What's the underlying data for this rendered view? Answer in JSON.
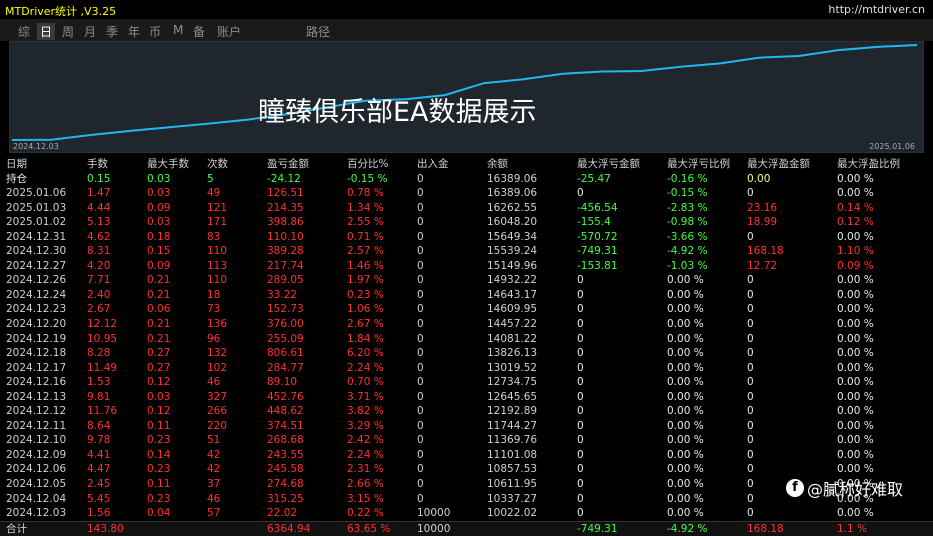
{
  "window": {
    "title": "MTDriver统计 ,V3.25",
    "url": "http://mtdriver.cn"
  },
  "tabs": [
    "综",
    "日",
    "周",
    "月",
    "季",
    "年",
    "币",
    "M",
    "备",
    "账户",
    "路径"
  ],
  "active_tab": "日",
  "chart": {
    "start_date": "2024.12.03",
    "end_date": "2025.01.06",
    "overlay": "瞳臻俱乐部EA数据展示",
    "line_color": "#1fb8f0"
  },
  "columns": [
    "日期",
    "手数",
    "最大手数",
    "次数",
    "盈亏金额",
    "百分比%",
    "出入金",
    "余额",
    "最大浮亏金额",
    "最大浮亏比例",
    "最大浮盈金额",
    "最大浮盈比例"
  ],
  "hold_row": [
    "持仓",
    "0.15",
    "0.03",
    "5",
    "-24.12",
    "-0.15 %",
    "0",
    "16389.06",
    "-25.47",
    "-0.16 %",
    "0.00",
    "0.00 %"
  ],
  "rows": [
    [
      "2025.01.06",
      "1.47",
      "0.03",
      "49",
      "126.51",
      "0.78 %",
      "0",
      "16389.06",
      "0",
      "-0.15 %",
      "0",
      "0.00 %"
    ],
    [
      "2025.01.03",
      "4.44",
      "0.09",
      "121",
      "214.35",
      "1.34 %",
      "0",
      "16262.55",
      "-456.54",
      "-2.83 %",
      "23.16",
      "0.14 %"
    ],
    [
      "2025.01.02",
      "5.13",
      "0.03",
      "171",
      "398.86",
      "2.55 %",
      "0",
      "16048.20",
      "-155.4",
      "-0.98 %",
      "18.99",
      "0.12 %"
    ],
    [
      "2024.12.31",
      "4.62",
      "0.18",
      "83",
      "110.10",
      "0.71 %",
      "0",
      "15649.34",
      "-570.72",
      "-3.66 %",
      "0",
      "0.00 %"
    ],
    [
      "2024.12.30",
      "8.31",
      "0.15",
      "110",
      "389.28",
      "2.57 %",
      "0",
      "15539.24",
      "-749.31",
      "-4.92 %",
      "168.18",
      "1.10 %"
    ],
    [
      "2024.12.27",
      "4.20",
      "0.09",
      "113",
      "217.74",
      "1.46 %",
      "0",
      "15149.96",
      "-153.81",
      "-1.03 %",
      "12.72",
      "0.09 %"
    ],
    [
      "2024.12.26",
      "7.71",
      "0.21",
      "110",
      "289.05",
      "1.97 %",
      "0",
      "14932.22",
      "0",
      "0.00 %",
      "0",
      "0.00 %"
    ],
    [
      "2024.12.24",
      "2.40",
      "0.21",
      "18",
      "33.22",
      "0.23 %",
      "0",
      "14643.17",
      "0",
      "0.00 %",
      "0",
      "0.00 %"
    ],
    [
      "2024.12.23",
      "2.67",
      "0.06",
      "73",
      "152.73",
      "1.06 %",
      "0",
      "14609.95",
      "0",
      "0.00 %",
      "0",
      "0.00 %"
    ],
    [
      "2024.12.20",
      "12.12",
      "0.21",
      "136",
      "376.00",
      "2.67 %",
      "0",
      "14457.22",
      "0",
      "0.00 %",
      "0",
      "0.00 %"
    ],
    [
      "2024.12.19",
      "10.95",
      "0.21",
      "96",
      "255.09",
      "1.84 %",
      "0",
      "14081.22",
      "0",
      "0.00 %",
      "0",
      "0.00 %"
    ],
    [
      "2024.12.18",
      "8.28",
      "0.27",
      "132",
      "806.61",
      "6.20 %",
      "0",
      "13826.13",
      "0",
      "0.00 %",
      "0",
      "0.00 %"
    ],
    [
      "2024.12.17",
      "11.49",
      "0.27",
      "102",
      "284.77",
      "2.24 %",
      "0",
      "13019.52",
      "0",
      "0.00 %",
      "0",
      "0.00 %"
    ],
    [
      "2024.12.16",
      "1.53",
      "0.12",
      "46",
      "89.10",
      "0.70 %",
      "0",
      "12734.75",
      "0",
      "0.00 %",
      "0",
      "0.00 %"
    ],
    [
      "2024.12.13",
      "9.81",
      "0.03",
      "327",
      "452.76",
      "3.71 %",
      "0",
      "12645.65",
      "0",
      "0.00 %",
      "0",
      "0.00 %"
    ],
    [
      "2024.12.12",
      "11.76",
      "0.12",
      "266",
      "448.62",
      "3.82 %",
      "0",
      "12192.89",
      "0",
      "0.00 %",
      "0",
      "0.00 %"
    ],
    [
      "2024.12.11",
      "8.64",
      "0.11",
      "220",
      "374.51",
      "3.29 %",
      "0",
      "11744.27",
      "0",
      "0.00 %",
      "0",
      "0.00 %"
    ],
    [
      "2024.12.10",
      "9.78",
      "0.23",
      "51",
      "268.68",
      "2.42 %",
      "0",
      "11369.76",
      "0",
      "0.00 %",
      "0",
      "0.00 %"
    ],
    [
      "2024.12.09",
      "4.41",
      "0.14",
      "42",
      "243.55",
      "2.24 %",
      "0",
      "11101.08",
      "0",
      "0.00 %",
      "0",
      "0.00 %"
    ],
    [
      "2024.12.06",
      "4.47",
      "0.23",
      "42",
      "245.58",
      "2.31 %",
      "0",
      "10857.53",
      "0",
      "0.00 %",
      "0",
      "0.00 %"
    ],
    [
      "2024.12.05",
      "2.45",
      "0.11",
      "37",
      "274.68",
      "2.66 %",
      "0",
      "10611.95",
      "0",
      "0.00 %",
      "0",
      "0.00 %"
    ],
    [
      "2024.12.04",
      "5.45",
      "0.23",
      "46",
      "315.25",
      "3.15 %",
      "0",
      "10337.27",
      "0",
      "0.00 %",
      "0",
      "0.00 %"
    ],
    [
      "2024.12.03",
      "1.56",
      "0.04",
      "57",
      "22.02",
      "0.22 %",
      "10000",
      "10022.02",
      "0",
      "0.00 %",
      "0",
      "0.00 %"
    ]
  ],
  "total_row": [
    "合计",
    "143.80",
    "",
    "",
    "6364.94",
    "63.65 %",
    "10000",
    "",
    "-749.31",
    "-4.92 %",
    "168.18",
    "1.1 %"
  ],
  "signature": "@膩称好难取",
  "signature_logo": "f",
  "colors": {
    "positive": "#ff3030",
    "negative": "#40ff40",
    "title": "#ffff00"
  }
}
